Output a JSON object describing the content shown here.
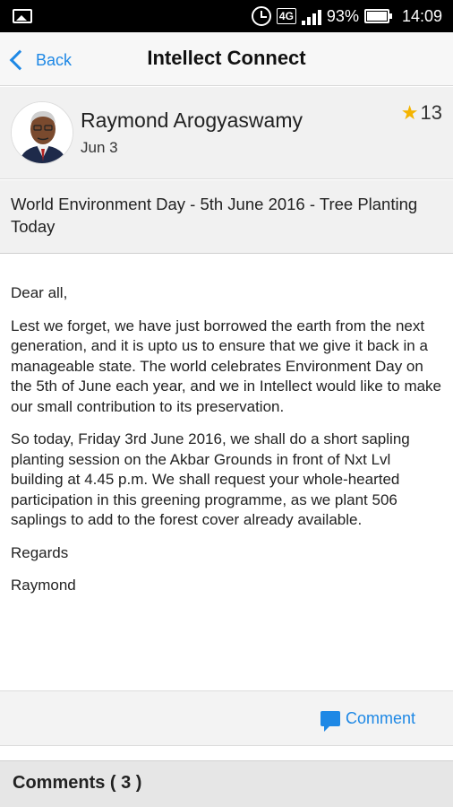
{
  "status_bar": {
    "network": "4G",
    "battery": "93%",
    "time": "14:09",
    "icons": [
      "image-icon",
      "alarm-icon",
      "signal-icon",
      "battery-icon"
    ]
  },
  "header": {
    "back_label": "Back",
    "title": "Intellect Connect"
  },
  "post": {
    "author": "Raymond Arogyaswamy",
    "date": "Jun 3",
    "rating": "13",
    "subject": "World Environment Day - 5th June 2016 - Tree Planting Today",
    "body": [
      "Dear all,",
      "Lest we forget, we have just borrowed the earth from the next generation, and it is upto us to ensure that we give it back in a manageable state. The world celebrates Environment Day on the 5th of June each year, and we in Intellect would like to make our small contribution to its preservation.",
      "So today, Friday 3rd June 2016, we shall do a short sapling planting session on the Akbar Grounds in front of Nxt Lvl building at 4.45 p.m. We shall request your whole-hearted participation in this greening programme, as we plant 506 saplings to add to the forest cover already available.",
      "Regards",
      "Raymond"
    ]
  },
  "actions": {
    "comment_label": "Comment"
  },
  "comments": {
    "header": "Comments ( 3 )"
  },
  "colors": {
    "accent": "#1e88e5",
    "star": "#f4b400"
  }
}
